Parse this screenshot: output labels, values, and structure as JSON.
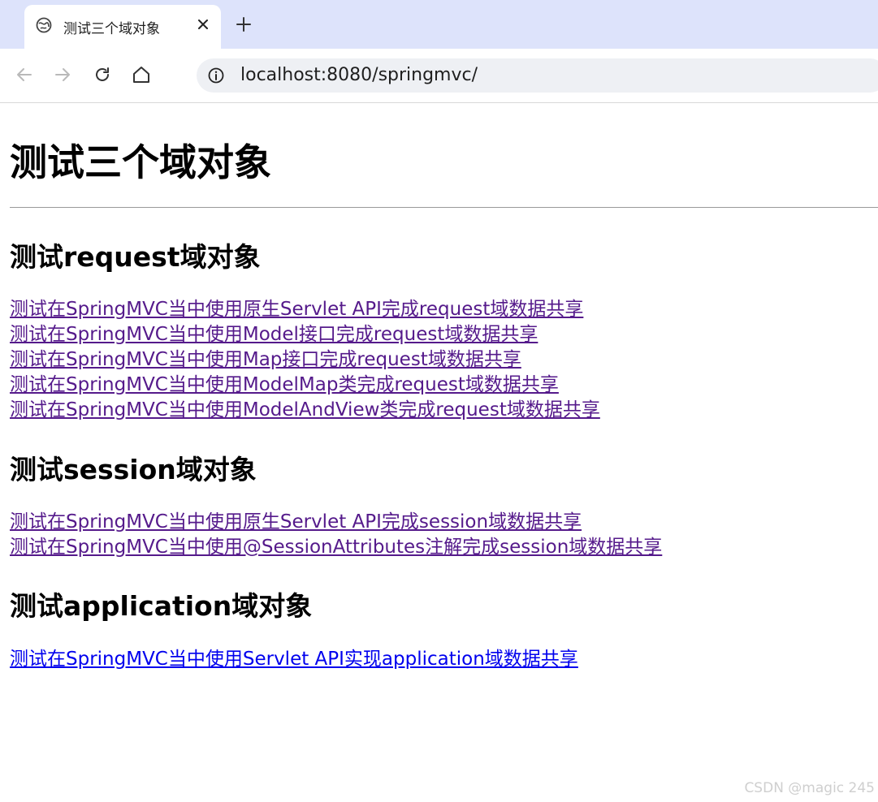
{
  "browser": {
    "tab": {
      "title": "测试三个域对象",
      "favicon": "globe-icon",
      "close": "close-icon"
    },
    "new_tab": "plus-icon",
    "nav": {
      "back": "back-arrow-icon",
      "forward": "forward-arrow-icon",
      "reload": "reload-icon",
      "home": "home-icon"
    },
    "address_bar": {
      "site_info": "info-icon",
      "url": "localhost:8080/springmvc/"
    }
  },
  "page": {
    "title": "测试三个域对象",
    "sections": [
      {
        "heading": "测试request域对象",
        "links": [
          {
            "text": "测试在SpringMVC当中使用原生Servlet API完成request域数据共享",
            "visited": true
          },
          {
            "text": "测试在SpringMVC当中使用Model接口完成request域数据共享",
            "visited": true
          },
          {
            "text": "测试在SpringMVC当中使用Map接口完成request域数据共享",
            "visited": true
          },
          {
            "text": "测试在SpringMVC当中使用ModelMap类完成request域数据共享",
            "visited": true
          },
          {
            "text": "测试在SpringMVC当中使用ModelAndView类完成request域数据共享",
            "visited": true
          }
        ]
      },
      {
        "heading": "测试session域对象",
        "links": [
          {
            "text": "测试在SpringMVC当中使用原生Servlet API完成session域数据共享",
            "visited": true
          },
          {
            "text": "测试在SpringMVC当中使用@SessionAttributes注解完成session域数据共享",
            "visited": true
          }
        ]
      },
      {
        "heading": "测试application域对象",
        "links": [
          {
            "text": "测试在SpringMVC当中使用Servlet API实现application域数据共享",
            "visited": false
          }
        ]
      }
    ]
  },
  "watermark": "CSDN @magic 245",
  "colors": {
    "tabstrip": "#dde3fb",
    "omnibox": "#eef0f4",
    "link_visited": "#551a8b",
    "link_unvisited": "#0000ee"
  }
}
